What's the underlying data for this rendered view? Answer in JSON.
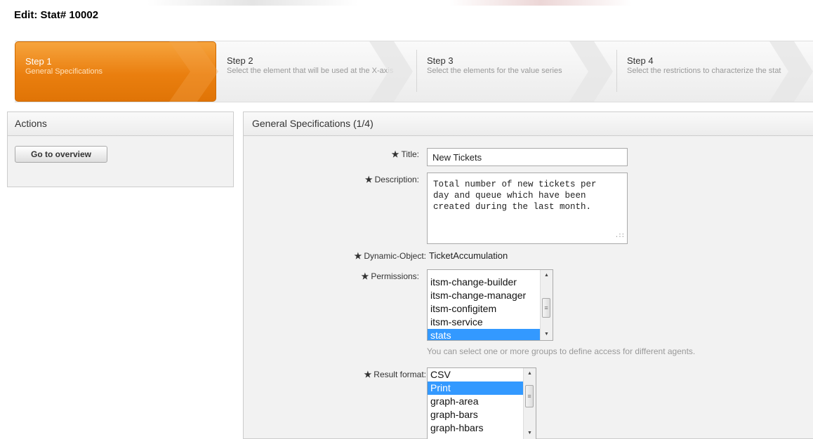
{
  "page": {
    "title": "Edit: Stat# 10002"
  },
  "steps": [
    {
      "num": "Step 1",
      "desc": "General Specifications",
      "active": true
    },
    {
      "num": "Step 2",
      "desc": "Select the element that will be used at the X-axis"
    },
    {
      "num": "Step 3",
      "desc": "Select the elements for the value series"
    },
    {
      "num": "Step 4",
      "desc": "Select the restrictions to characterize the stat"
    }
  ],
  "sidebar": {
    "title": "Actions",
    "overview_button": "Go to overview"
  },
  "main": {
    "title": "General Specifications (1/4)",
    "required_mark": "★",
    "title_field": {
      "label": "Title:",
      "value": "New Tickets"
    },
    "description_field": {
      "label": "Description:",
      "value": "Total number of new tickets per\nday and queue which have been\ncreated during the last month."
    },
    "dynamic_object": {
      "label": "Dynamic-Object:",
      "value": "TicketAccumulation"
    },
    "permissions": {
      "label": "Permissions:",
      "options": [
        "itsm-change-builder",
        "itsm-change-manager",
        "itsm-configitem",
        "itsm-service",
        "stats"
      ],
      "selected": "stats",
      "hint": "You can select one or more groups to define access for different agents."
    },
    "result_format": {
      "label": "Result format:",
      "options": [
        "CSV",
        "Print",
        "graph-area",
        "graph-bars",
        "graph-hbars"
      ],
      "selected": "Print"
    }
  },
  "colors": {
    "active_step": "#ea7f0f",
    "selection": "#3399ff"
  },
  "icons": {
    "required": "star-icon",
    "scroll_up": "arrow-up-icon",
    "scroll_down": "arrow-down-icon",
    "resize": "resize-grip-icon"
  }
}
